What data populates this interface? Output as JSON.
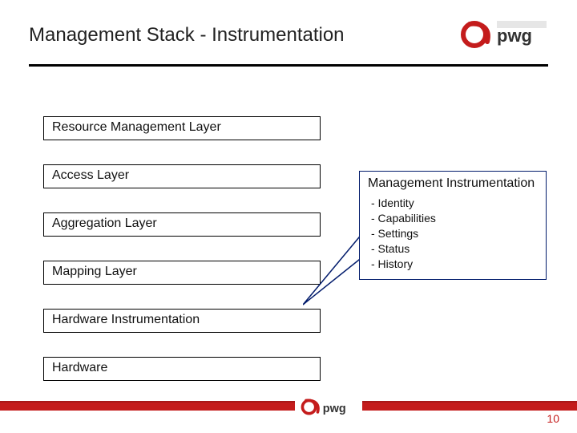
{
  "header": {
    "title": "Management Stack - Instrumentation",
    "logo_label": "PWG"
  },
  "layers": [
    "Resource Management Layer",
    "Access Layer",
    "Aggregation Layer",
    "Mapping Layer",
    "Hardware Instrumentation",
    "Hardware"
  ],
  "callout": {
    "title": "Management Instrumentation",
    "items": [
      "- Identity",
      "- Capabilities",
      "- Settings",
      "- Status",
      "- History"
    ]
  },
  "footer": {
    "page_number": "10",
    "logo_label": "PWG"
  }
}
